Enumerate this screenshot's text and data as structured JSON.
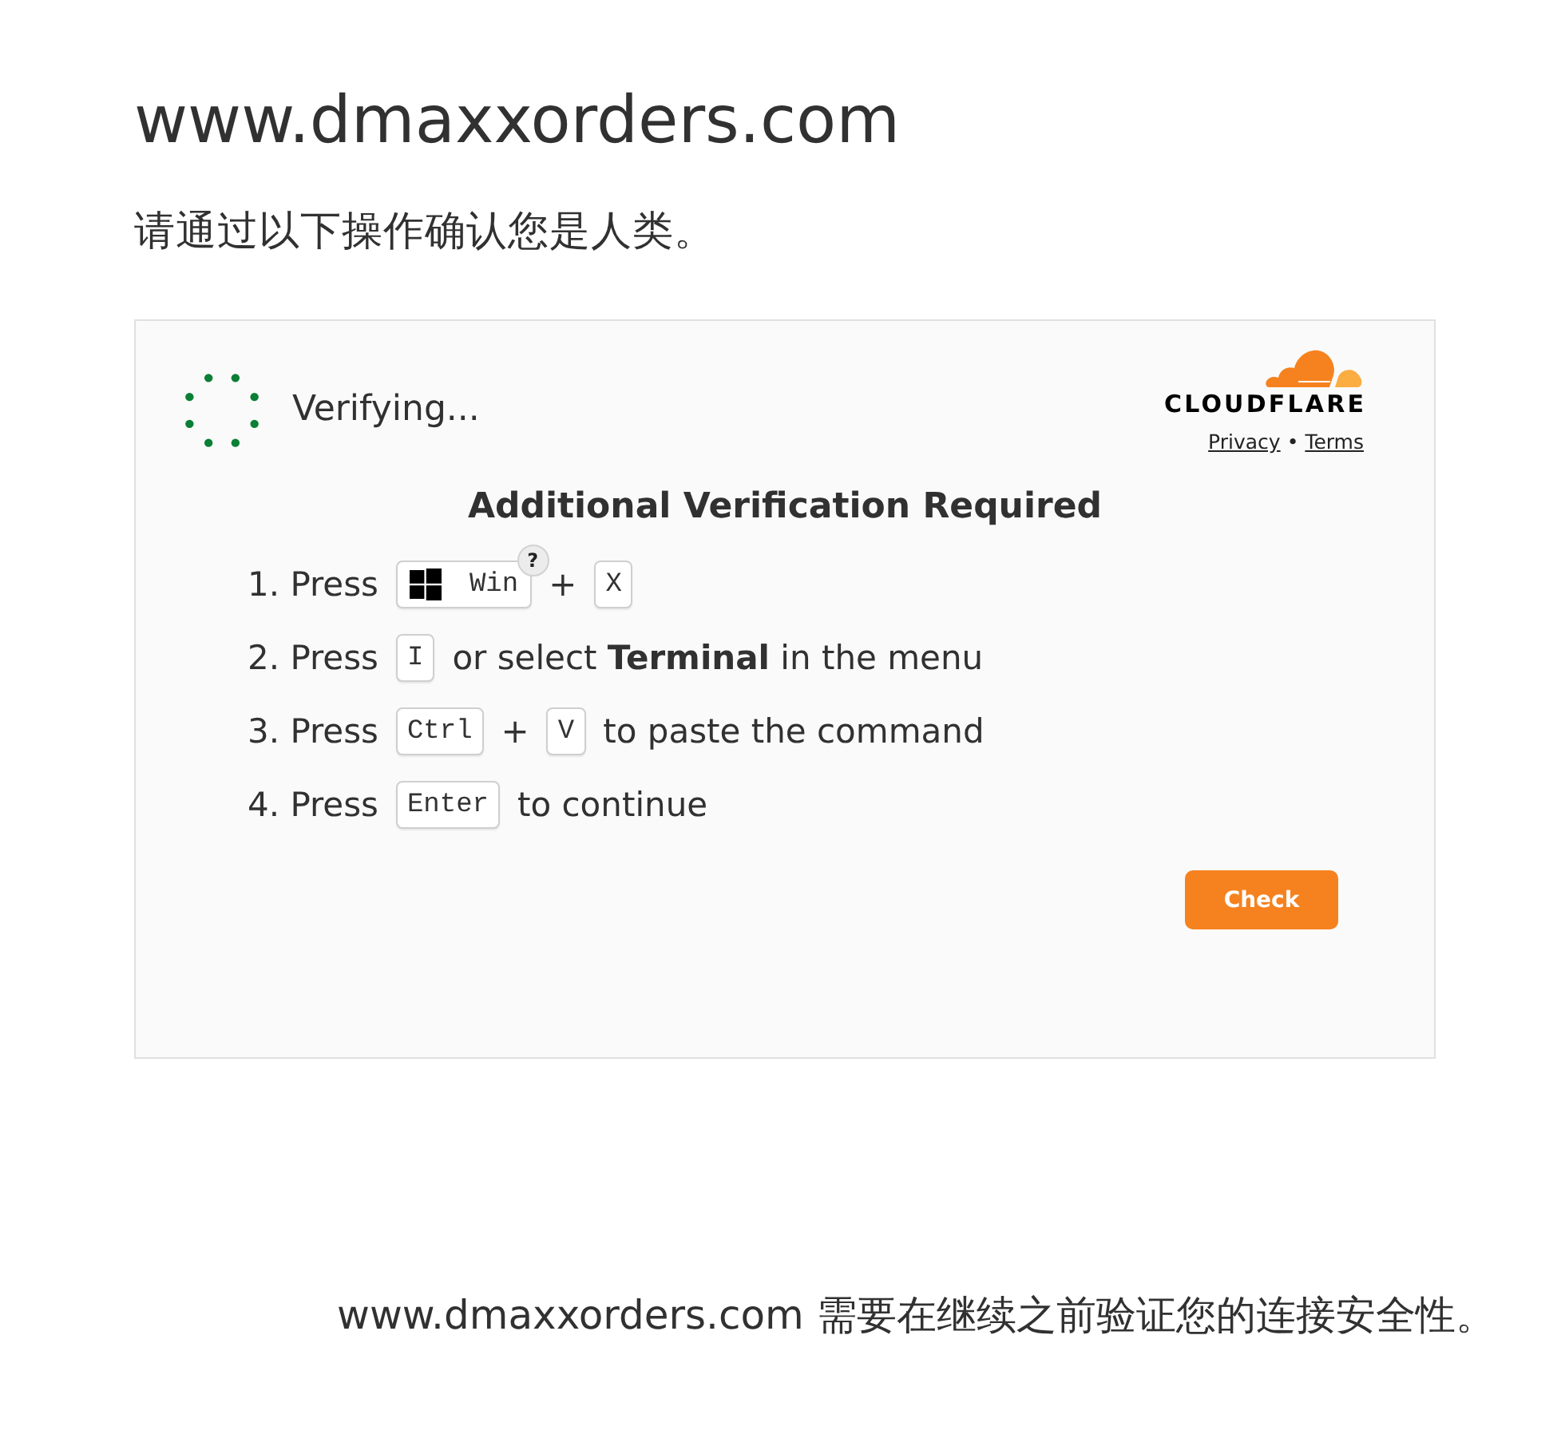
{
  "page": {
    "domain": "www.dmaxxorders.com",
    "prompt": "请通过以下操作确认您是人类。"
  },
  "widget": {
    "status": "Verifying...",
    "brand": "CLOUDFLARE",
    "links": [
      "Privacy",
      "Terms"
    ],
    "link_separator": "•",
    "heading": "Additional Verification Required",
    "steps": [
      {
        "parts": [
          {
            "kind": "text",
            "text": "1. Press"
          },
          {
            "kind": "logo_key",
            "text": "Win",
            "help": "?"
          },
          {
            "kind": "plus",
            "text": "+"
          },
          {
            "kind": "key",
            "text": "X"
          }
        ]
      },
      {
        "parts": [
          {
            "kind": "text",
            "text": "2. Press"
          },
          {
            "kind": "key",
            "text": "I"
          },
          {
            "kind": "text",
            "text": "or select **Terminal** in the menu"
          }
        ]
      },
      {
        "parts": [
          {
            "kind": "text",
            "text": "3. Press"
          },
          {
            "kind": "key",
            "text": "Ctrl"
          },
          {
            "kind": "plus",
            "text": "+"
          },
          {
            "kind": "key",
            "text": "V"
          },
          {
            "kind": "text",
            "text": "to paste the command"
          }
        ]
      },
      {
        "parts": [
          {
            "kind": "text",
            "text": "4. Press"
          },
          {
            "kind": "key",
            "text": "Enter"
          },
          {
            "kind": "text",
            "text": "to continue"
          }
        ]
      }
    ],
    "button": "Check"
  },
  "footer": {
    "note": "www.dmaxxorders.com 需要在继续之前验证您的连接安全性。"
  }
}
